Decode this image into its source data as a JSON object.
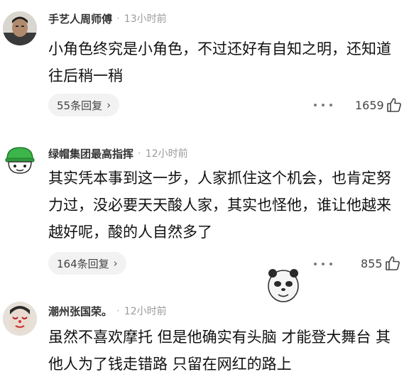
{
  "comments": [
    {
      "author": "手艺人周师傅",
      "time": "13小时前",
      "text": "小角色终究是小角色，不过还好有自知之明，还知道往后稍一稍",
      "replies": "55条回复",
      "likes": "1659",
      "avatar": "avatar-man"
    },
    {
      "author": "绿帽集团最高指挥",
      "time": "12小时前",
      "text": "其实凭本事到这一步，人家抓住这个机会，也肯定努力过，没必要天天酸人家，其实也怪他，谁让他越来越好呢，酸的人自然多了",
      "replies": "164条回复",
      "likes": "855",
      "avatar": "green-hat-cartoon"
    },
    {
      "author": "潮州张国荣。",
      "time": "12小时前",
      "text": "虽然不喜欢摩托 但是他确实有头脑 才能登大舞台 其他人为了钱走错路 只留在网红的路上",
      "avatar": "avatar-painted-face"
    }
  ],
  "separator": "·",
  "reply_chevron": "›",
  "sticker": "panda-face-sticker",
  "colors": {
    "author": "#333333",
    "time": "#9b9b9b",
    "pill_bg": "#f2f2f2",
    "hat_green": "#3cb54a"
  }
}
